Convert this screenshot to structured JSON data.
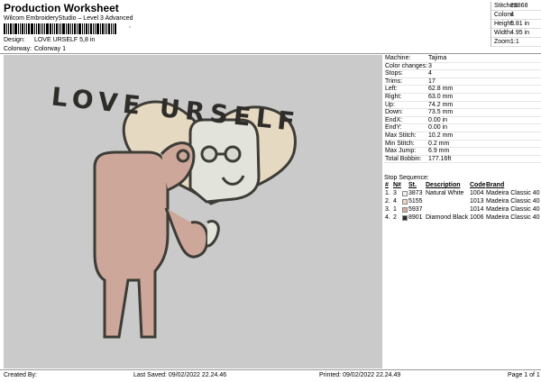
{
  "header": {
    "title": "Production Worksheet",
    "subtitle": "Wilcom EmbroideryStudio – Level 3 Advanced",
    "barcode_suffix": ",",
    "design_label": "Design:",
    "design_value": "LOVE URSELF 5,8 in",
    "colorway_label": "Colorway:",
    "colorway_value": "Colorway 1"
  },
  "stats": [
    {
      "label": "Stitches:",
      "value": "23868"
    },
    {
      "label": "Colors:",
      "value": "4"
    },
    {
      "label": "Height:",
      "value": "5.81 in"
    },
    {
      "label": "Width:",
      "value": "4.95 in"
    },
    {
      "label": "Zoom:",
      "value": "1:1"
    }
  ],
  "design_text": "LOVE URSELF",
  "properties": [
    {
      "label": "Machine:",
      "value": "Tajima"
    },
    {
      "label": "Color changes:",
      "value": "3"
    },
    {
      "label": "Stops:",
      "value": "4"
    },
    {
      "label": "Trims:",
      "value": "17"
    },
    {
      "label": "Left:",
      "value": "62.8 mm"
    },
    {
      "label": "Right:",
      "value": "63.0 mm"
    },
    {
      "label": "Up:",
      "value": "74.2 mm"
    },
    {
      "label": "Down:",
      "value": "73.5 mm"
    },
    {
      "label": "EndX:",
      "value": "0.00 in"
    },
    {
      "label": "EndY:",
      "value": "0.00 in"
    },
    {
      "label": "Max Stitch:",
      "value": "10.2 mm"
    },
    {
      "label": "Min Stitch:",
      "value": "0.2 mm"
    },
    {
      "label": "Max Jump:",
      "value": "6.9 mm"
    },
    {
      "label": "Total Bobbin:",
      "value": "177.16ft"
    }
  ],
  "sequence": {
    "title": "Stop Sequence:",
    "columns": {
      "hash": "#",
      "n": "N#",
      "st": "St.",
      "desc": "Description",
      "code": "Code",
      "brand": "Brand"
    },
    "rows": [
      {
        "hash": "1.",
        "n": "3",
        "st": "3873",
        "desc": "Natural White",
        "code": "1004",
        "brand": "Madeira Classic 40",
        "color": "#f1f0e6"
      },
      {
        "hash": "2.",
        "n": "4",
        "st": "5155",
        "desc": "",
        "code": "1013",
        "brand": "Madeira Classic 40",
        "color": "#efd6c4"
      },
      {
        "hash": "3.",
        "n": "1",
        "st": "5937",
        "desc": "",
        "code": "1014",
        "brand": "Madeira Classic 40",
        "color": "#dcaaa0"
      },
      {
        "hash": "4.",
        "n": "2",
        "st": "8901",
        "desc": "Diamond Black",
        "code": "1006",
        "brand": "Madeira Classic 40",
        "color": "#2a2a2a"
      }
    ]
  },
  "footer": {
    "created_by": "Created By:",
    "last_saved": "Last Saved: 09/02/2022 22.24.46",
    "printed": "Printed: 09/02/2022 22.24.49",
    "page": "Page 1 of 1"
  },
  "colors": {
    "canvas_bg": "#cacaca",
    "heart": "#e6d9c2",
    "body": "#cda79a",
    "mirror_face": "#e2e4dc",
    "outline": "#3e3c36"
  }
}
